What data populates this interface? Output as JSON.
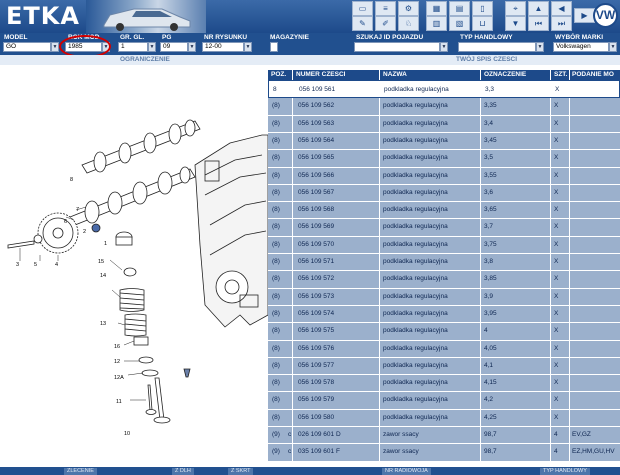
{
  "app": {
    "title": "ETKA",
    "brand": "VW"
  },
  "toolbar": {
    "icons": [
      "monitor-icon",
      "list-icon",
      "bicycle-icon",
      "grid-icon",
      "catalog-icon",
      "page-icon",
      "cart-icon",
      "pin-icon",
      "up-icon",
      "arrow-left-icon",
      "first-icon",
      "last-icon",
      "next-icon"
    ]
  },
  "filters": {
    "model": {
      "label": "MODEL",
      "value": "GO"
    },
    "rok": {
      "label": "ROK MOD.",
      "value": "1985"
    },
    "gr": {
      "label": "GR. GL.",
      "value": "1"
    },
    "pg": {
      "label": "PG",
      "value": "09"
    },
    "nr": {
      "label": "NR RYSUNKU",
      "value": "12-00"
    },
    "magazynie": {
      "label": "MAGAZYNIE"
    },
    "szukaj": {
      "label": "SZUKAJ ID POJAZDU",
      "value": ""
    },
    "typ": {
      "label": "TYP HANDLOWY",
      "value": ""
    },
    "wybor": {
      "label": "WYBÓR MARKI",
      "value": "Volkswagen"
    }
  },
  "subbar": {
    "left": "OGRANICZENIE",
    "right": "TWÓJ SPIS CZESCI"
  },
  "table": {
    "headers": {
      "poz": "POZ.",
      "numer": "NUMER CZESCI",
      "nazwa": "NAZWA",
      "oznaczenie": "OZNACZENIE",
      "szt": "SZT.",
      "podanie": "PODANIE MO"
    },
    "rows": [
      {
        "poz": "8",
        "c": "",
        "numer": "056  109  561",
        "nazwa": "podkladka regulacyjna",
        "oznaczenie": "3,3",
        "szt": "X",
        "podanie": ""
      },
      {
        "poz": "(8)",
        "c": "",
        "numer": "056  109  562",
        "nazwa": "podkladka regulacyjna",
        "oznaczenie": "3,35",
        "szt": "X",
        "podanie": ""
      },
      {
        "poz": "(8)",
        "c": "",
        "numer": "056  109  563",
        "nazwa": "podkladka regulacyjna",
        "oznaczenie": "3,4",
        "szt": "X",
        "podanie": ""
      },
      {
        "poz": "(8)",
        "c": "",
        "numer": "056  109  564",
        "nazwa": "podkladka regulacyjna",
        "oznaczenie": "3,45",
        "szt": "X",
        "podanie": ""
      },
      {
        "poz": "(8)",
        "c": "",
        "numer": "056  109  565",
        "nazwa": "podkladka regulacyjna",
        "oznaczenie": "3,5",
        "szt": "X",
        "podanie": ""
      },
      {
        "poz": "(8)",
        "c": "",
        "numer": "056  109  566",
        "nazwa": "podkladka regulacyjna",
        "oznaczenie": "3,55",
        "szt": "X",
        "podanie": ""
      },
      {
        "poz": "(8)",
        "c": "",
        "numer": "056  109  567",
        "nazwa": "podkladka regulacyjna",
        "oznaczenie": "3,6",
        "szt": "X",
        "podanie": ""
      },
      {
        "poz": "(8)",
        "c": "",
        "numer": "056  109  568",
        "nazwa": "podkladka regulacyjna",
        "oznaczenie": "3,65",
        "szt": "X",
        "podanie": ""
      },
      {
        "poz": "(8)",
        "c": "",
        "numer": "056  109  569",
        "nazwa": "podkladka regulacyjna",
        "oznaczenie": "3,7",
        "szt": "X",
        "podanie": ""
      },
      {
        "poz": "(8)",
        "c": "",
        "numer": "056  109  570",
        "nazwa": "podkladka regulacyjna",
        "oznaczenie": "3,75",
        "szt": "X",
        "podanie": ""
      },
      {
        "poz": "(8)",
        "c": "",
        "numer": "056  109  571",
        "nazwa": "podkladka regulacyjna",
        "oznaczenie": "3,8",
        "szt": "X",
        "podanie": ""
      },
      {
        "poz": "(8)",
        "c": "",
        "numer": "056  109  572",
        "nazwa": "podkladka regulacyjna",
        "oznaczenie": "3,85",
        "szt": "X",
        "podanie": ""
      },
      {
        "poz": "(8)",
        "c": "",
        "numer": "056  109  573",
        "nazwa": "podkladka regulacyjna",
        "oznaczenie": "3,9",
        "szt": "X",
        "podanie": ""
      },
      {
        "poz": "(8)",
        "c": "",
        "numer": "056  109  574",
        "nazwa": "podkladka regulacyjna",
        "oznaczenie": "3,95",
        "szt": "X",
        "podanie": ""
      },
      {
        "poz": "(8)",
        "c": "",
        "numer": "056  109  575",
        "nazwa": "podkladka regulacyjna",
        "oznaczenie": "4",
        "szt": "X",
        "podanie": ""
      },
      {
        "poz": "(8)",
        "c": "",
        "numer": "056  109  576",
        "nazwa": "podkladka regulacyjna",
        "oznaczenie": "4,05",
        "szt": "X",
        "podanie": ""
      },
      {
        "poz": "(8)",
        "c": "",
        "numer": "056  109  577",
        "nazwa": "podkladka regulacyjna",
        "oznaczenie": "4,1",
        "szt": "X",
        "podanie": ""
      },
      {
        "poz": "(8)",
        "c": "",
        "numer": "056  109  578",
        "nazwa": "podkladka regulacyjna",
        "oznaczenie": "4,15",
        "szt": "X",
        "podanie": ""
      },
      {
        "poz": "(8)",
        "c": "",
        "numer": "056  109  579",
        "nazwa": "podkladka regulacyjna",
        "oznaczenie": "4,2",
        "szt": "X",
        "podanie": ""
      },
      {
        "poz": "(8)",
        "c": "",
        "numer": "056  109  580",
        "nazwa": "podkladka regulacyjna",
        "oznaczenie": "4,25",
        "szt": "X",
        "podanie": ""
      },
      {
        "poz": "(9)",
        "c": "c",
        "numer": "026  109  601  D",
        "nazwa": "zawor ssacy",
        "oznaczenie": "98,7",
        "szt": "4",
        "podanie": "EV,GZ"
      },
      {
        "poz": "(9)",
        "c": "c",
        "numer": "035  109  601  F",
        "nazwa": "zawor ssacy",
        "oznaczenie": "98,7",
        "szt": "4",
        "podanie": "EZ,HM,GU,HV"
      }
    ]
  },
  "diagram": {
    "callouts": [
      "8",
      "7",
      "6",
      "5",
      "4",
      "3",
      "2",
      "1",
      "15",
      "14",
      "13",
      "16",
      "12",
      "12A",
      "11",
      "10"
    ]
  },
  "bottombar": {
    "buttons": [
      "ZLECENIE",
      "Z DLH",
      "Z SKRT",
      "NR RADIOWOJA",
      "TYP HANDLOWY"
    ]
  },
  "colors": {
    "header": "#1d4a8a",
    "tableBg": "#9bb0cc",
    "highlight": "#d20000"
  }
}
